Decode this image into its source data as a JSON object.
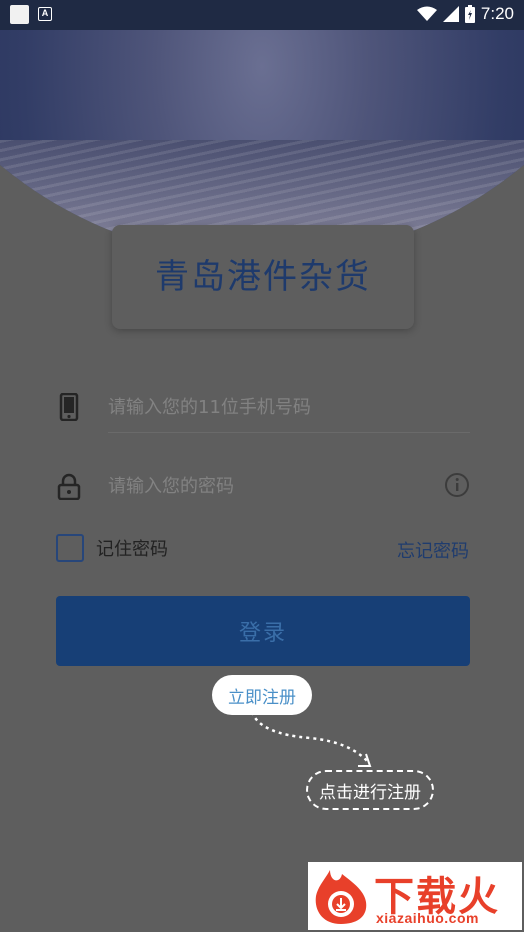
{
  "status_bar": {
    "time": "7:20",
    "notification_icon": "a-box-icon",
    "icons": [
      "wifi-icon",
      "signal-icon",
      "battery-icon"
    ]
  },
  "app": {
    "title": "青岛港件杂货"
  },
  "form": {
    "phone_placeholder": "请输入您的11位手机号码",
    "password_placeholder": "请输入您的密码",
    "remember_label": "记住密码",
    "forgot_label": "忘记密码",
    "login_label": "登录"
  },
  "guide": {
    "register_label": "立即注册",
    "hint_label": "点击进行注册"
  },
  "watermark": {
    "brand": "下载火",
    "domain": "xiazaihuo.com"
  },
  "colors": {
    "primary": "#173f76",
    "accent_text": "#1f3c6e",
    "overlay": "#5e5e5e",
    "watermark": "#e8402a"
  }
}
